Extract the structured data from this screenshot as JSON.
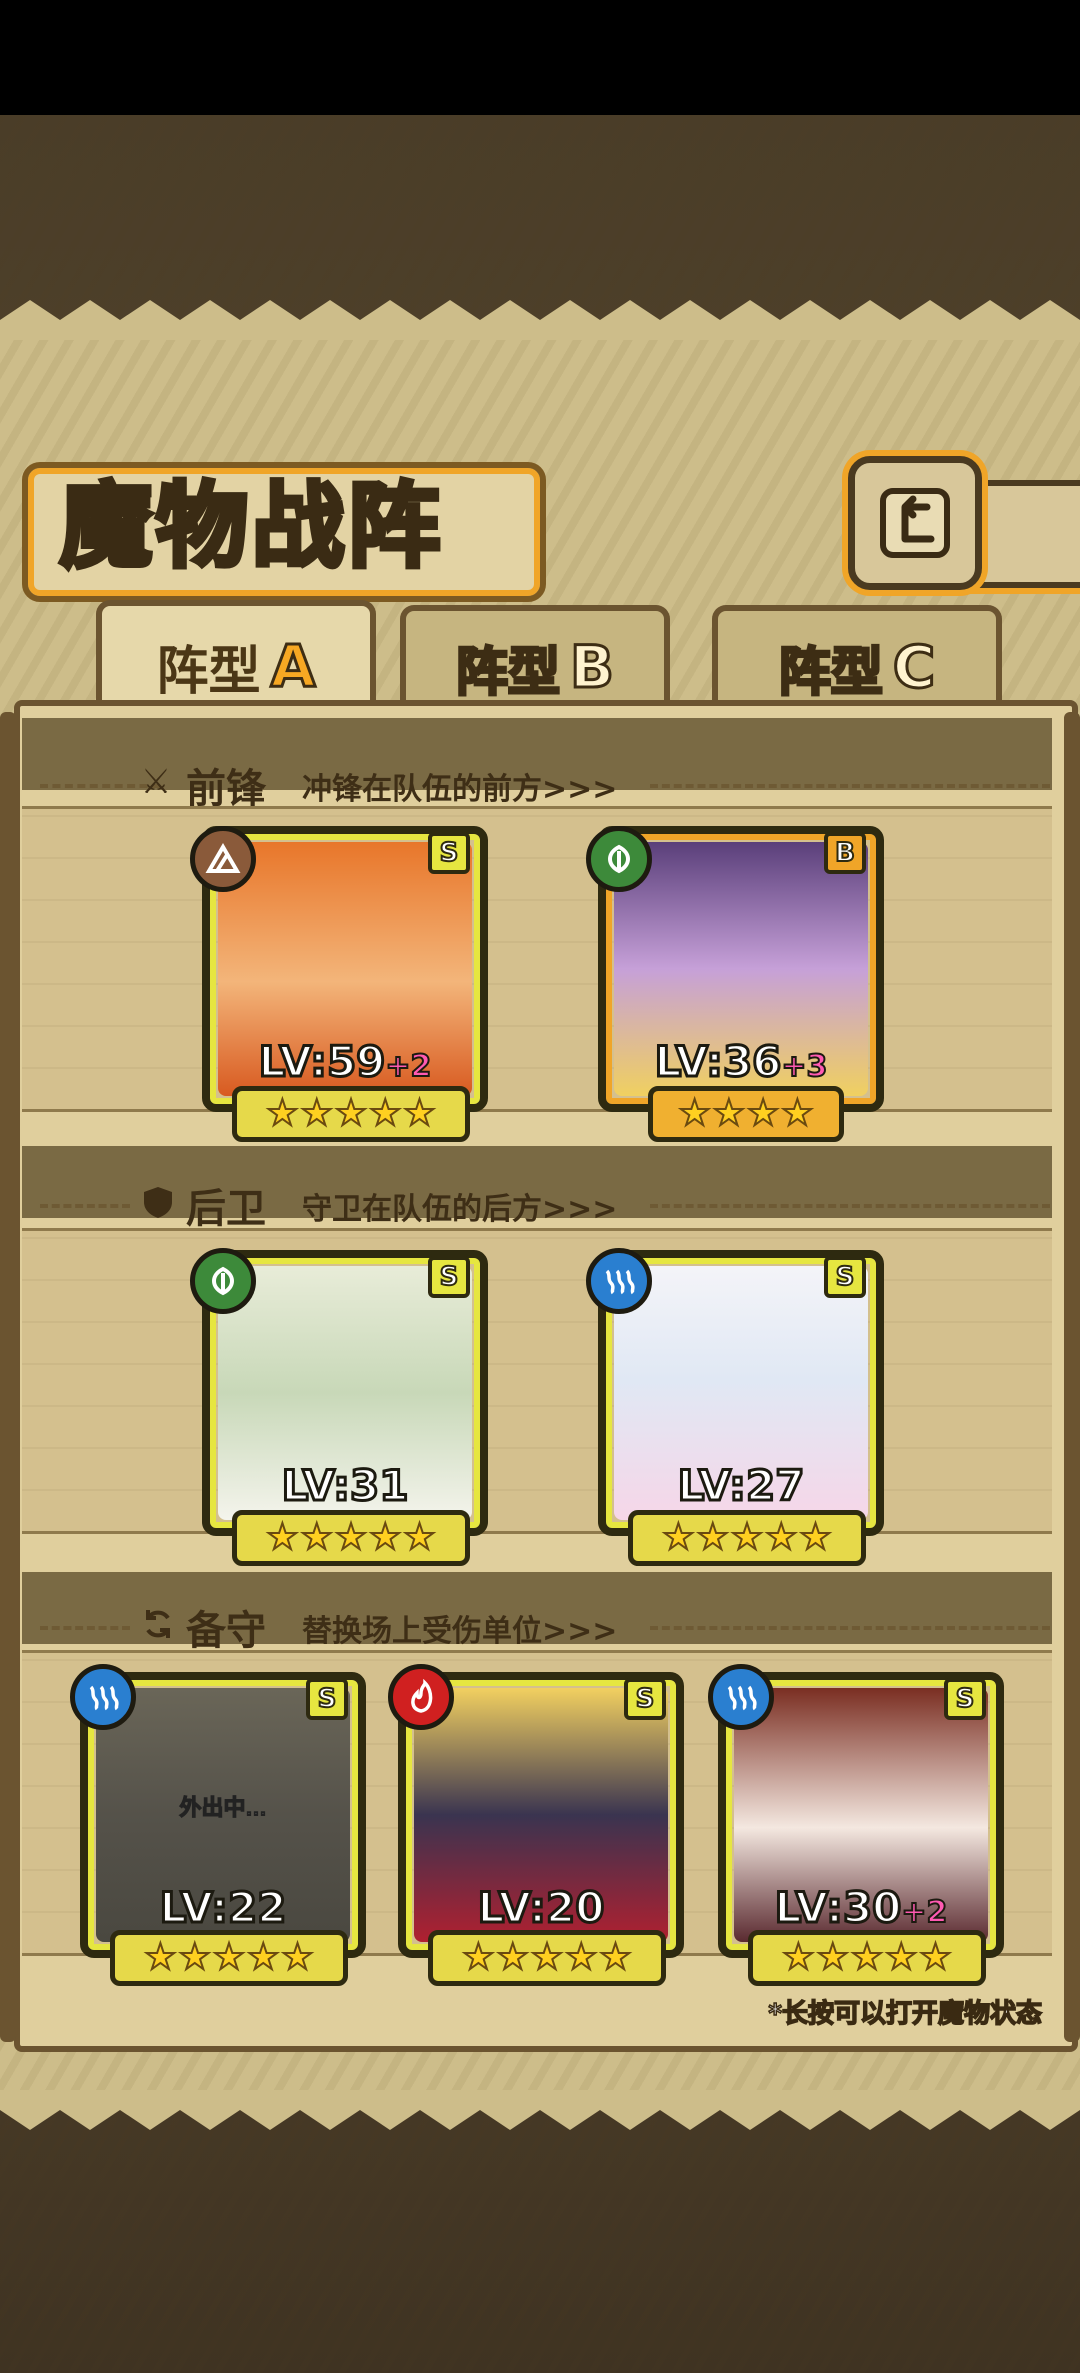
{
  "page": {
    "title": "魔物战阵",
    "footnote": "*长按可以打开魔物状态"
  },
  "tabs": [
    {
      "prefix": "阵型",
      "letter": "A",
      "active": true
    },
    {
      "prefix": "阵型",
      "letter": "B",
      "active": false
    },
    {
      "prefix": "阵型",
      "letter": "C",
      "active": false
    }
  ],
  "sections": {
    "front": {
      "title": "前锋",
      "subtitle": "冲锋在队伍的前方>>>",
      "icon": "sword-icon"
    },
    "rear": {
      "title": "后卫",
      "subtitle": "守卫在队伍的后方>>>",
      "icon": "shield-icon"
    },
    "reserve": {
      "title": "备守",
      "subtitle": "替换场上受伤单位>>>",
      "icon": "swap-icon"
    }
  },
  "monsters": {
    "front_1": {
      "level": "LV:59",
      "bonus": "+2",
      "rank": "S",
      "stars": 5,
      "element": "earth-icon",
      "status": ""
    },
    "front_2": {
      "level": "LV:36",
      "bonus": "+3",
      "rank": "B",
      "stars": 4,
      "element": "leaf-icon",
      "status": ""
    },
    "rear_1": {
      "level": "LV:31",
      "bonus": "",
      "rank": "S",
      "stars": 5,
      "element": "leaf-icon",
      "status": ""
    },
    "rear_2": {
      "level": "LV:27",
      "bonus": "",
      "rank": "S",
      "stars": 5,
      "element": "water-icon",
      "status": ""
    },
    "reserve_1": {
      "level": "LV:22",
      "bonus": "",
      "rank": "S",
      "stars": 5,
      "element": "water-icon",
      "status": "外出中..."
    },
    "reserve_2": {
      "level": "LV:20",
      "bonus": "",
      "rank": "S",
      "stars": 5,
      "element": "fire-icon",
      "status": ""
    },
    "reserve_3": {
      "level": "LV:30",
      "bonus": "+2",
      "rank": "S",
      "stars": 5,
      "element": "water-icon",
      "status": ""
    }
  },
  "colors": {
    "accent_orange": "#f0a528",
    "frame_yellow": "#e6e640",
    "bonus_pink": "#ff5ab2",
    "earth": "#8a5a3a",
    "leaf": "#3d8a3a",
    "water": "#2a7fd0",
    "fire": "#d02020"
  }
}
